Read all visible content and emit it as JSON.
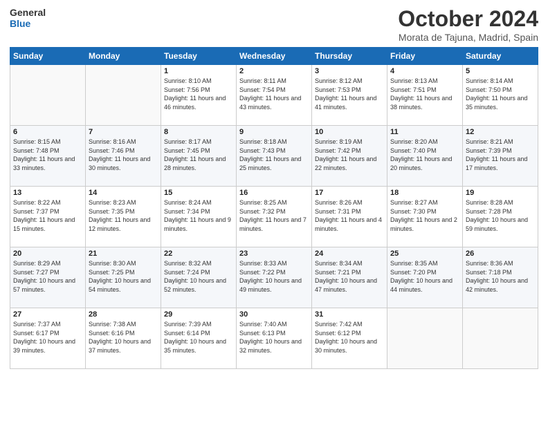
{
  "header": {
    "logo_line1": "General",
    "logo_line2": "Blue",
    "month": "October 2024",
    "location": "Morata de Tajuna, Madrid, Spain"
  },
  "days_of_week": [
    "Sunday",
    "Monday",
    "Tuesday",
    "Wednesday",
    "Thursday",
    "Friday",
    "Saturday"
  ],
  "weeks": [
    [
      {
        "day": "",
        "info": ""
      },
      {
        "day": "",
        "info": ""
      },
      {
        "day": "1",
        "info": "Sunrise: 8:10 AM\nSunset: 7:56 PM\nDaylight: 11 hours and 46 minutes."
      },
      {
        "day": "2",
        "info": "Sunrise: 8:11 AM\nSunset: 7:54 PM\nDaylight: 11 hours and 43 minutes."
      },
      {
        "day": "3",
        "info": "Sunrise: 8:12 AM\nSunset: 7:53 PM\nDaylight: 11 hours and 41 minutes."
      },
      {
        "day": "4",
        "info": "Sunrise: 8:13 AM\nSunset: 7:51 PM\nDaylight: 11 hours and 38 minutes."
      },
      {
        "day": "5",
        "info": "Sunrise: 8:14 AM\nSunset: 7:50 PM\nDaylight: 11 hours and 35 minutes."
      }
    ],
    [
      {
        "day": "6",
        "info": "Sunrise: 8:15 AM\nSunset: 7:48 PM\nDaylight: 11 hours and 33 minutes."
      },
      {
        "day": "7",
        "info": "Sunrise: 8:16 AM\nSunset: 7:46 PM\nDaylight: 11 hours and 30 minutes."
      },
      {
        "day": "8",
        "info": "Sunrise: 8:17 AM\nSunset: 7:45 PM\nDaylight: 11 hours and 28 minutes."
      },
      {
        "day": "9",
        "info": "Sunrise: 8:18 AM\nSunset: 7:43 PM\nDaylight: 11 hours and 25 minutes."
      },
      {
        "day": "10",
        "info": "Sunrise: 8:19 AM\nSunset: 7:42 PM\nDaylight: 11 hours and 22 minutes."
      },
      {
        "day": "11",
        "info": "Sunrise: 8:20 AM\nSunset: 7:40 PM\nDaylight: 11 hours and 20 minutes."
      },
      {
        "day": "12",
        "info": "Sunrise: 8:21 AM\nSunset: 7:39 PM\nDaylight: 11 hours and 17 minutes."
      }
    ],
    [
      {
        "day": "13",
        "info": "Sunrise: 8:22 AM\nSunset: 7:37 PM\nDaylight: 11 hours and 15 minutes."
      },
      {
        "day": "14",
        "info": "Sunrise: 8:23 AM\nSunset: 7:35 PM\nDaylight: 11 hours and 12 minutes."
      },
      {
        "day": "15",
        "info": "Sunrise: 8:24 AM\nSunset: 7:34 PM\nDaylight: 11 hours and 9 minutes."
      },
      {
        "day": "16",
        "info": "Sunrise: 8:25 AM\nSunset: 7:32 PM\nDaylight: 11 hours and 7 minutes."
      },
      {
        "day": "17",
        "info": "Sunrise: 8:26 AM\nSunset: 7:31 PM\nDaylight: 11 hours and 4 minutes."
      },
      {
        "day": "18",
        "info": "Sunrise: 8:27 AM\nSunset: 7:30 PM\nDaylight: 11 hours and 2 minutes."
      },
      {
        "day": "19",
        "info": "Sunrise: 8:28 AM\nSunset: 7:28 PM\nDaylight: 10 hours and 59 minutes."
      }
    ],
    [
      {
        "day": "20",
        "info": "Sunrise: 8:29 AM\nSunset: 7:27 PM\nDaylight: 10 hours and 57 minutes."
      },
      {
        "day": "21",
        "info": "Sunrise: 8:30 AM\nSunset: 7:25 PM\nDaylight: 10 hours and 54 minutes."
      },
      {
        "day": "22",
        "info": "Sunrise: 8:32 AM\nSunset: 7:24 PM\nDaylight: 10 hours and 52 minutes."
      },
      {
        "day": "23",
        "info": "Sunrise: 8:33 AM\nSunset: 7:22 PM\nDaylight: 10 hours and 49 minutes."
      },
      {
        "day": "24",
        "info": "Sunrise: 8:34 AM\nSunset: 7:21 PM\nDaylight: 10 hours and 47 minutes."
      },
      {
        "day": "25",
        "info": "Sunrise: 8:35 AM\nSunset: 7:20 PM\nDaylight: 10 hours and 44 minutes."
      },
      {
        "day": "26",
        "info": "Sunrise: 8:36 AM\nSunset: 7:18 PM\nDaylight: 10 hours and 42 minutes."
      }
    ],
    [
      {
        "day": "27",
        "info": "Sunrise: 7:37 AM\nSunset: 6:17 PM\nDaylight: 10 hours and 39 minutes."
      },
      {
        "day": "28",
        "info": "Sunrise: 7:38 AM\nSunset: 6:16 PM\nDaylight: 10 hours and 37 minutes."
      },
      {
        "day": "29",
        "info": "Sunrise: 7:39 AM\nSunset: 6:14 PM\nDaylight: 10 hours and 35 minutes."
      },
      {
        "day": "30",
        "info": "Sunrise: 7:40 AM\nSunset: 6:13 PM\nDaylight: 10 hours and 32 minutes."
      },
      {
        "day": "31",
        "info": "Sunrise: 7:42 AM\nSunset: 6:12 PM\nDaylight: 10 hours and 30 minutes."
      },
      {
        "day": "",
        "info": ""
      },
      {
        "day": "",
        "info": ""
      }
    ]
  ]
}
